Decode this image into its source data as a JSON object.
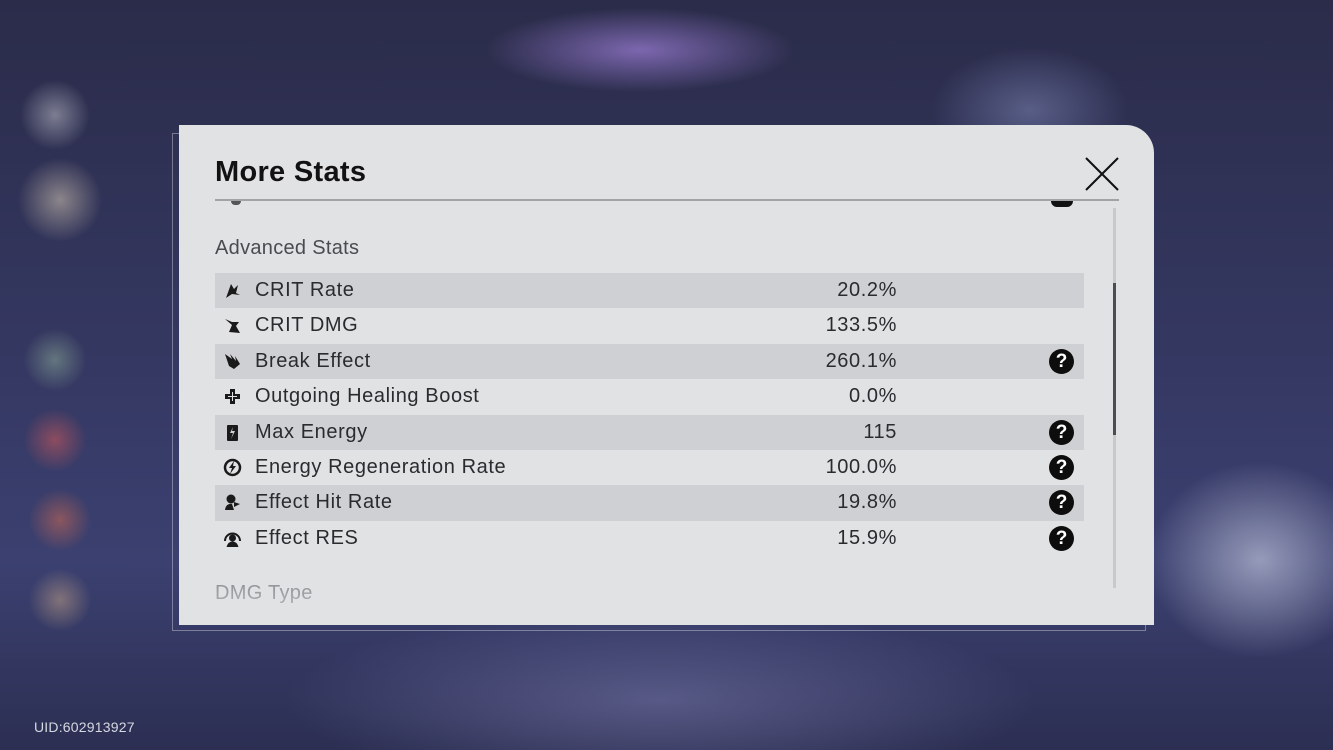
{
  "panel": {
    "title": "More Stats",
    "close_icon": "close-x-icon"
  },
  "section": {
    "title": "Advanced Stats"
  },
  "stats": [
    {
      "icon": "crit-rate-icon",
      "label": "CRIT Rate",
      "value": "20.2%",
      "help": false
    },
    {
      "icon": "crit-dmg-icon",
      "label": "CRIT DMG",
      "value": "133.5%",
      "help": false
    },
    {
      "icon": "break-effect-icon",
      "label": "Break Effect",
      "value": "260.1%",
      "help": true
    },
    {
      "icon": "healing-boost-icon",
      "label": "Outgoing Healing Boost",
      "value": "0.0%",
      "help": false
    },
    {
      "icon": "max-energy-icon",
      "label": "Max Energy",
      "value": "115",
      "help": true
    },
    {
      "icon": "energy-regen-icon",
      "label": "Energy Regeneration Rate",
      "value": "100.0%",
      "help": true
    },
    {
      "icon": "effect-hit-rate-icon",
      "label": "Effect Hit Rate",
      "value": "19.8%",
      "help": true
    },
    {
      "icon": "effect-res-icon",
      "label": "Effect RES",
      "value": "15.9%",
      "help": true
    }
  ],
  "help_symbol": "?",
  "next_section": {
    "title": "DMG Type"
  },
  "footer": {
    "uid": "UID:602913927"
  },
  "colors": {
    "panel_bg": "#e1e2e4",
    "row_alt": "#cfd0d3",
    "text": "#2a2b2e",
    "title": "#121212",
    "help_bg": "#0d0d0d"
  }
}
